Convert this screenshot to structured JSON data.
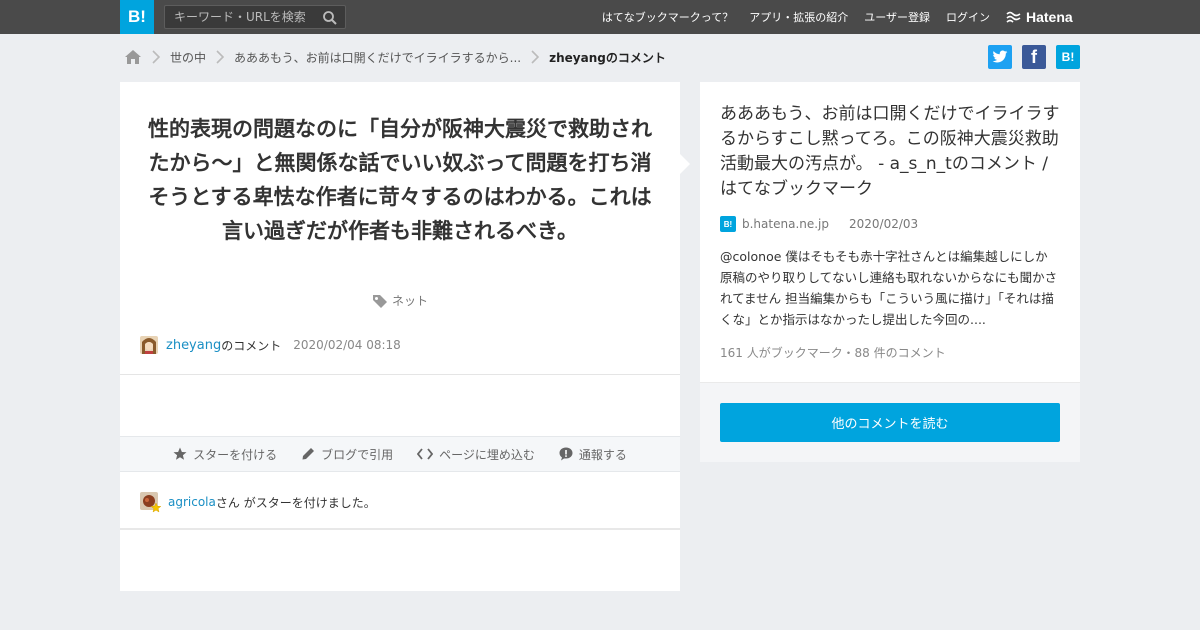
{
  "topbar": {
    "logo": "B!",
    "search_placeholder": "キーワード・URLを検索",
    "nav": [
      "はてなブックマークって？",
      "アプリ・拡張の紹介",
      "ユーザー登録",
      "ログイン"
    ],
    "brand": "Hatena"
  },
  "breadcrumb": {
    "items": [
      "世の中",
      "あああもう、お前は口開くだけでイライラするから..."
    ],
    "current": "zheyangのコメント"
  },
  "share": {
    "twitter": "t",
    "facebook": "f",
    "hatena": "B!"
  },
  "comment": {
    "text": "性的表現の問題なのに「自分が阪神大震災で救助されたから～」と無関係な話でいい奴ぶって問題を打ち消そうとする卑怯な作者に苛々するのはわかる。これは言い過ぎだが作者も非難されるべき。",
    "tag": "ネット",
    "author": "zheyang",
    "author_suffix": "のコメント",
    "time": "2020/02/04 08:18"
  },
  "actions": {
    "star": "スターを付ける",
    "blog": "ブログで引用",
    "embed": "ページに埋め込む",
    "report": "通報する"
  },
  "star_notice": {
    "user": "agricola",
    "text": "さん がスターを付けました。"
  },
  "side": {
    "title": "あああもう、お前は口開くだけでイライラするからすこし黙ってろ。この阪神大震災救助活動最大の汚点が。 - a_s_n_tのコメント / はてなブックマーク",
    "favicon": "B!",
    "domain": "b.hatena.ne.jp",
    "date": "2020/02/03",
    "description": "@colonoe 僕はそもそも赤十字社さんとは編集越しにしか原稿のやり取りしてないし連絡も取れないからなにも聞かされてません 担当編集からも「こういう風に描け」「それは描くな」とか指示はなかったし提出した今回の....",
    "stats": "161 人がブックマーク・88 件のコメント",
    "button": "他のコメントを読む"
  },
  "colors": {
    "accent": "#00a4de",
    "topbar": "#4a4a4a",
    "link": "#1a8fc4"
  }
}
